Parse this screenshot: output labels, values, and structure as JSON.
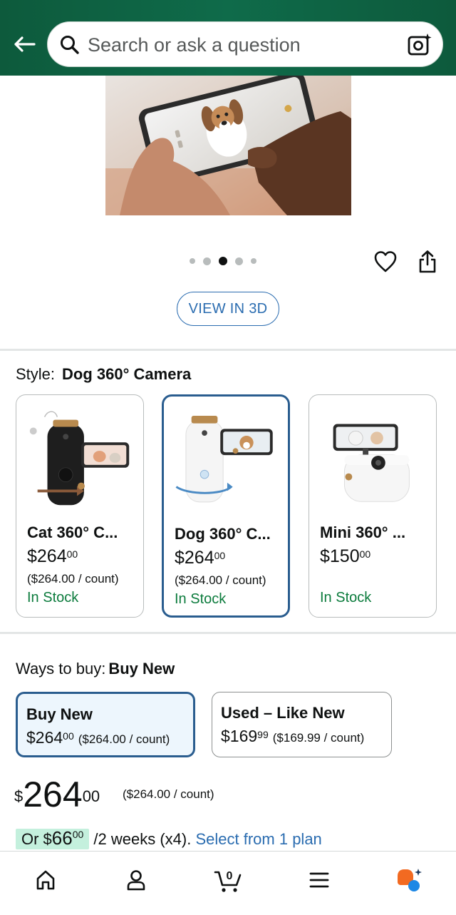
{
  "header": {
    "search_placeholder": "Search or ask a question"
  },
  "carousel": {
    "dot_count": 5,
    "active_index": 2
  },
  "view_3d_label": "VIEW IN 3D",
  "style": {
    "label": "Style:",
    "value": "Dog 360° Camera",
    "options": [
      {
        "name": "Cat 360° C...",
        "price_dollars": "$264",
        "price_cents": "00",
        "unit_price": "($264.00 / count)",
        "stock": "In Stock",
        "selected": false
      },
      {
        "name": "Dog 360° C...",
        "price_dollars": "$264",
        "price_cents": "00",
        "unit_price": "($264.00 / count)",
        "stock": "In Stock",
        "selected": true
      },
      {
        "name": "Mini 360° ...",
        "price_dollars": "$150",
        "price_cents": "00",
        "unit_price": "",
        "stock": "In Stock",
        "selected": false
      }
    ]
  },
  "ways_to_buy": {
    "label": "Ways to buy:",
    "value": "Buy New",
    "options": [
      {
        "title": "Buy New",
        "price_dollars": "$264",
        "price_cents": "00",
        "unit_price": "($264.00 / count)",
        "selected": true
      },
      {
        "title": "Used – Like New",
        "price_dollars": "$169",
        "price_cents": "99",
        "unit_price": "($169.99 / count)",
        "selected": false
      }
    ]
  },
  "price": {
    "currency": "$",
    "dollars": "264",
    "cents": "00",
    "unit_price": "($264.00 / count)"
  },
  "plan": {
    "prefix": "Or $",
    "dollars": "66",
    "cents": "00",
    "term": "/2 weeks (x4).",
    "link": "Select from 1 plan"
  },
  "colors": {
    "header_green": "#0f6b4a",
    "link_blue": "#2a6cb0",
    "in_stock_green": "#0b7b3c",
    "selected_border": "#2a5d8f"
  },
  "bottom_nav": {
    "icons": [
      "home-icon",
      "account-icon",
      "cart-icon",
      "menu-icon",
      "assistant-icon"
    ],
    "cart_count": "0"
  }
}
